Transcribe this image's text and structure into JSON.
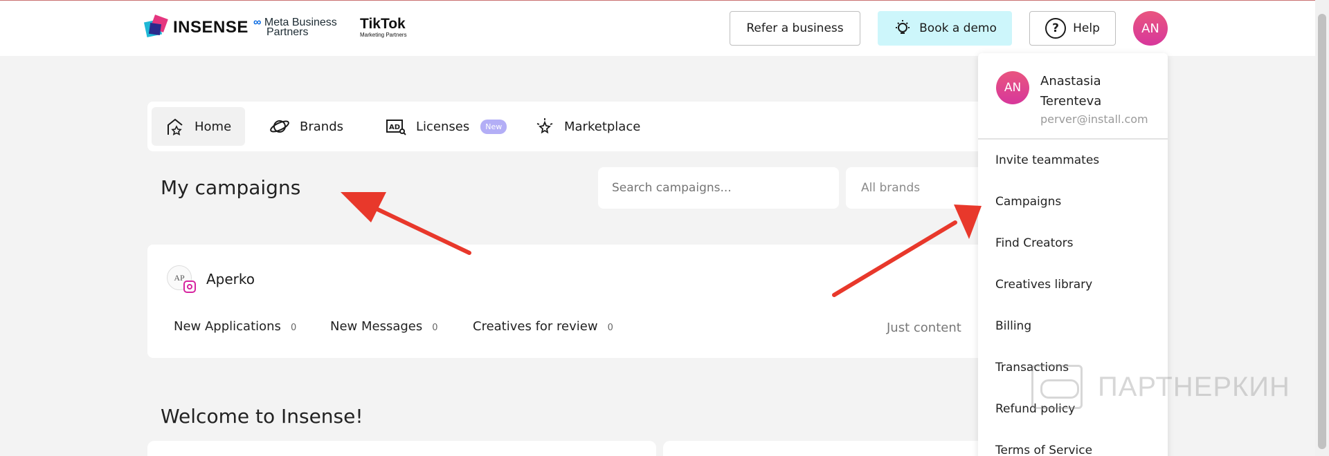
{
  "header": {
    "brand_name": "INSENSE",
    "meta_line1": "Meta Business",
    "meta_line2": "Partners",
    "tiktok_line1": "TikTok",
    "tiktok_line2": "Marketing Partners",
    "refer_label": "Refer a business",
    "demo_label": "Book a demo",
    "help_label": "Help",
    "help_glyph": "?",
    "avatar_initials": "AN"
  },
  "nav": {
    "items": [
      {
        "label": "Home",
        "icon": "home-star-icon"
      },
      {
        "label": "Brands",
        "icon": "planet-icon"
      },
      {
        "label": "Licenses",
        "icon": "ad-license-icon",
        "badge": "New"
      },
      {
        "label": "Marketplace",
        "icon": "sparkle-icon"
      }
    ]
  },
  "main": {
    "title": "My campaigns",
    "search_placeholder": "Search campaigns...",
    "brands_filter": "All brands",
    "welcome_title": "Welcome to Insense!"
  },
  "campaign": {
    "logo_text": "AP",
    "brand": "Aperko",
    "stats": [
      {
        "label": "New Applications",
        "value": "0"
      },
      {
        "label": "New Messages",
        "value": "0"
      },
      {
        "label": "Creatives for review",
        "value": "0"
      }
    ],
    "type": "Just content"
  },
  "account_menu": {
    "initials": "AN",
    "name": "Anastasia Terenteva",
    "email": "perver@install.com",
    "items": [
      "Invite teammates",
      "Campaigns",
      "Find Creators",
      "Creatives library",
      "Billing",
      "Transactions",
      "Refund policy",
      "Terms of Service"
    ]
  },
  "watermark": "ПАРТНЕРКИН",
  "colors": {
    "avatar_gradient_start": "#e9557f",
    "avatar_gradient_end": "#d7379b",
    "demo_button_bg": "#cdf6fb",
    "badge_new_bg": "#b3aef6",
    "annotation_arrow": "#e8382b"
  }
}
